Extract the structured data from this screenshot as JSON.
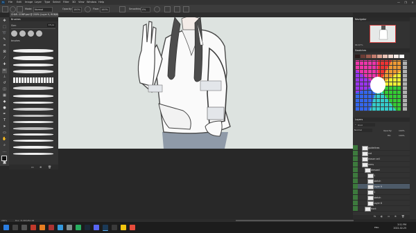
{
  "menu": {
    "app_icon": "Ps",
    "items": [
      "File",
      "Edit",
      "Image",
      "Layer",
      "Type",
      "Select",
      "Filter",
      "3D",
      "View",
      "Window",
      "Help"
    ],
    "window_controls": [
      "—",
      "❐",
      "✕"
    ]
  },
  "options": {
    "mode_label": "Mode:",
    "mode_value": "Normal",
    "opacity_label": "Opacity:",
    "opacity_value": "100%",
    "flow_label": "Flow:",
    "flow_value": "100%",
    "smoothing_label": "Smoothing:",
    "smoothing_value": "0%"
  },
  "document": {
    "tab_title": "CHAR. COMP.psd @ 200% (Layer 9, RGB/8)",
    "zoom": "200%",
    "doc_info": "Doc: 31.8M/284.4M"
  },
  "brushes": {
    "title": "Brushes",
    "size_label": "Size:",
    "size_value": "15 px",
    "folder": "brushes"
  },
  "navigator": {
    "title": "Navigator",
    "zoom": "66.67%"
  },
  "swatches": {
    "title": "Swatches",
    "colors": [
      "#2b1a1a",
      "#6b3c35",
      "#9a5a4e",
      "#c07b6d",
      "#d9a393",
      "#e8c2b5",
      "#f0d8cf",
      "#f7ece7",
      "#ffffff"
    ]
  },
  "layers": {
    "title": "Layers",
    "kind_label": "Kind",
    "mode_value": "Normal",
    "opacity_label": "Opacity:",
    "opacity_value": "100%",
    "fill_label": "Fill:",
    "fill_value": "100%",
    "rows": [
      {
        "name": "guidelines",
        "visible": true,
        "indent": 0
      },
      {
        "name": "cat",
        "visible": true,
        "indent": 0
      },
      {
        "name": "eraser cell",
        "visible": true,
        "indent": 0
      },
      {
        "name": "arms",
        "visible": true,
        "indent": 0
      },
      {
        "name": "dressed",
        "visible": true,
        "indent": 1
      },
      {
        "name": "1",
        "visible": true,
        "indent": 2
      },
      {
        "name": "sketch",
        "visible": true,
        "indent": 2
      },
      {
        "name": "Layer 9",
        "visible": true,
        "indent": 2,
        "selected": true
      },
      {
        "name": "1",
        "visible": true,
        "indent": 2
      },
      {
        "name": "sketch",
        "visible": true,
        "indent": 2
      },
      {
        "name": "Layer 8",
        "visible": true,
        "indent": 2
      },
      {
        "name": "front",
        "visible": true,
        "indent": 1
      }
    ]
  },
  "taskbar": {
    "time": "3:51 PM",
    "date": "2022-02-25",
    "lang": "ENG"
  }
}
